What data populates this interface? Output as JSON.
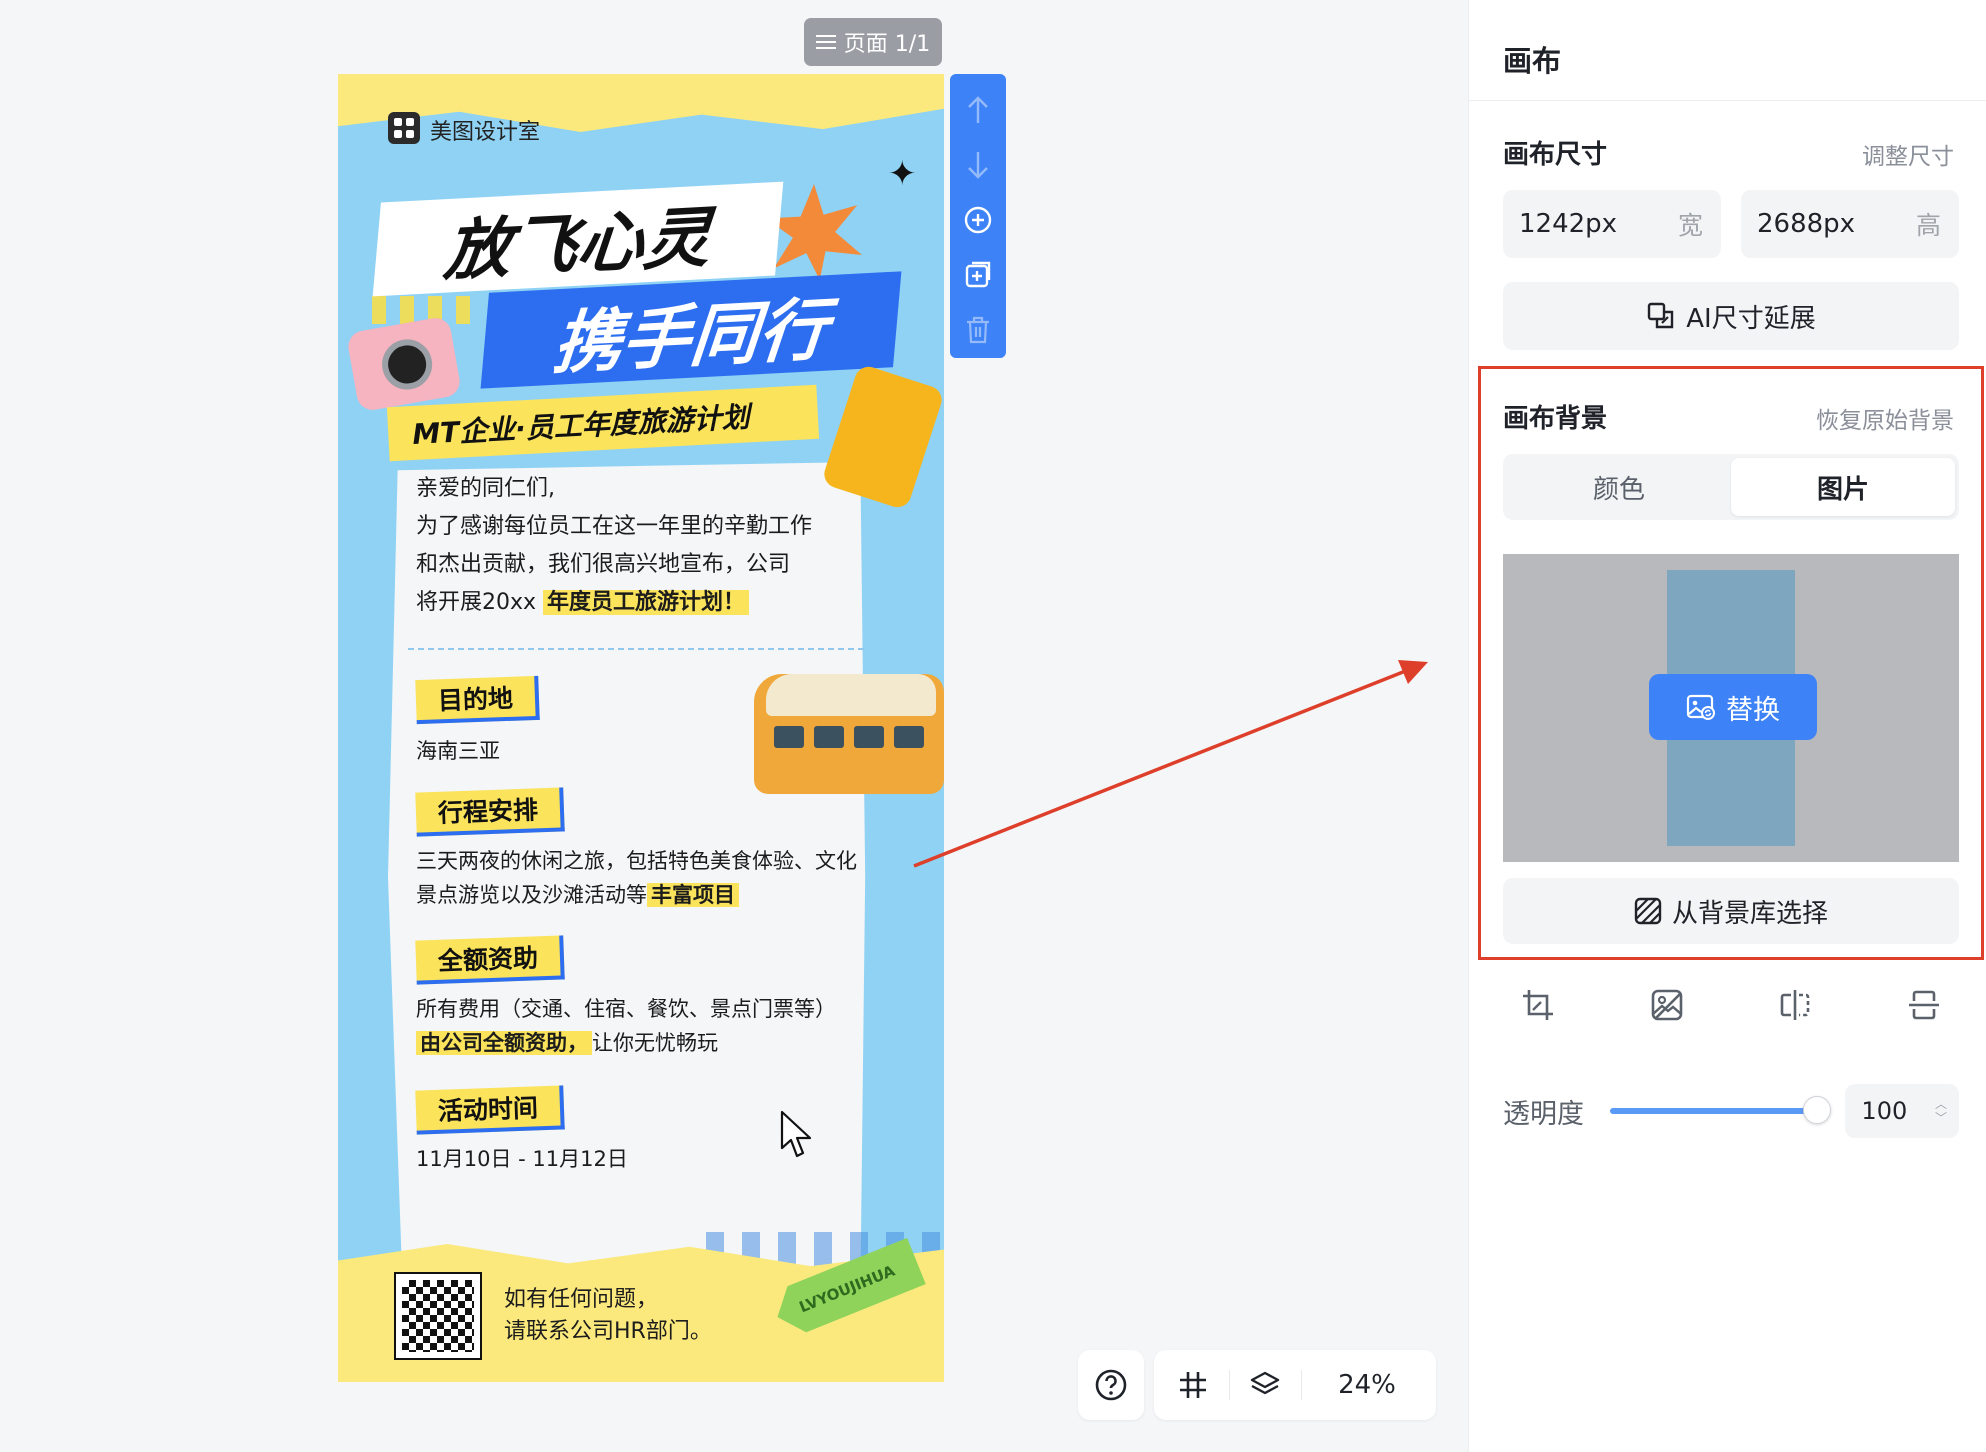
{
  "canvas": {
    "page_indicator": "页面 1/1",
    "zoom": "24%"
  },
  "poster": {
    "brand": "美图设计室",
    "title_line1": "放飞心灵",
    "title_line2": "携手同行",
    "subtitle": "MT企业·员工年度旅游计划",
    "intro": [
      "亲爱的同仁们,",
      "为了感谢每位员工在这一年里的辛勤工作",
      "和杰出贡献，我们很高兴地宣布，公司",
      "将开展20xx"
    ],
    "intro_highlight": "年度员工旅游计划！",
    "sections": [
      {
        "tag": "目的地",
        "text": "海南三亚",
        "highlight": ""
      },
      {
        "tag": "行程安排",
        "text": "三天两夜的休闲之旅，包括特色美食体验、文化景点游览以及沙滩活动等",
        "highlight": "丰富项目"
      },
      {
        "tag": "全额资助",
        "text": "所有费用（交通、住宿、餐饮、景点门票等）",
        "highlight": "由公司全额资助，",
        "after": "让你无忧畅玩"
      },
      {
        "tag": "活动时间",
        "text": "11月10日 - 11月12日",
        "highlight": ""
      }
    ],
    "footer_line1": "如有任何问题，",
    "footer_line2": "请联系公司HR部门。",
    "arrow_label": "LVYOUJIHUA"
  },
  "panel": {
    "title": "画布",
    "size_section": {
      "title": "画布尺寸",
      "adjust_link": "调整尺寸",
      "width_value": "1242px",
      "width_unit": "宽",
      "height_value": "2688px",
      "height_unit": "高",
      "ai_extend_label": "AI尺寸延展"
    },
    "bg_section": {
      "title": "画布背景",
      "restore_link": "恢复原始背景",
      "tabs": [
        "颜色",
        "图片"
      ],
      "active_tab": "图片",
      "replace_label": "替换",
      "library_label": "从背景库选择"
    },
    "opacity": {
      "label": "透明度",
      "value": "100"
    }
  },
  "colors": {
    "accent_blue": "#3d82f6",
    "highlight_red": "#de3f2a",
    "poster_yellow": "#fbe35b",
    "poster_sky": "#8fd2f4"
  },
  "icons": [
    "list-icon",
    "arrow-up-icon",
    "arrow-down-icon",
    "add-circle-icon",
    "duplicate-icon",
    "trash-icon",
    "help-icon",
    "grid-icon",
    "layers-icon",
    "resize-icon",
    "image-replace-icon",
    "texture-icon",
    "crop-icon",
    "no-image-icon",
    "flip-horizontal-icon",
    "flip-vertical-icon",
    "cursor-icon"
  ]
}
